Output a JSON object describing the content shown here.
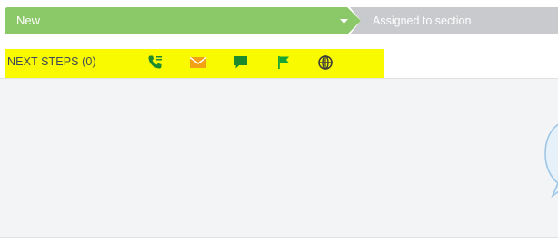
{
  "stages": {
    "current": {
      "label": "New",
      "color": "#8bc867"
    },
    "next": {
      "label": "Assigned to section",
      "color": "#c8cacd"
    }
  },
  "next_steps": {
    "label": "NEXT STEPS (0)",
    "highlight_color": "#f9f900",
    "actions": [
      {
        "icon": "phone-icon",
        "color": "#1d8a2e"
      },
      {
        "icon": "email-icon",
        "color": "#f2a112"
      },
      {
        "icon": "chat-icon",
        "color": "#1d8a2e"
      },
      {
        "icon": "flag-icon",
        "color": "#18a533"
      },
      {
        "icon": "globe-icon",
        "color": "#3a3a3a"
      }
    ]
  }
}
